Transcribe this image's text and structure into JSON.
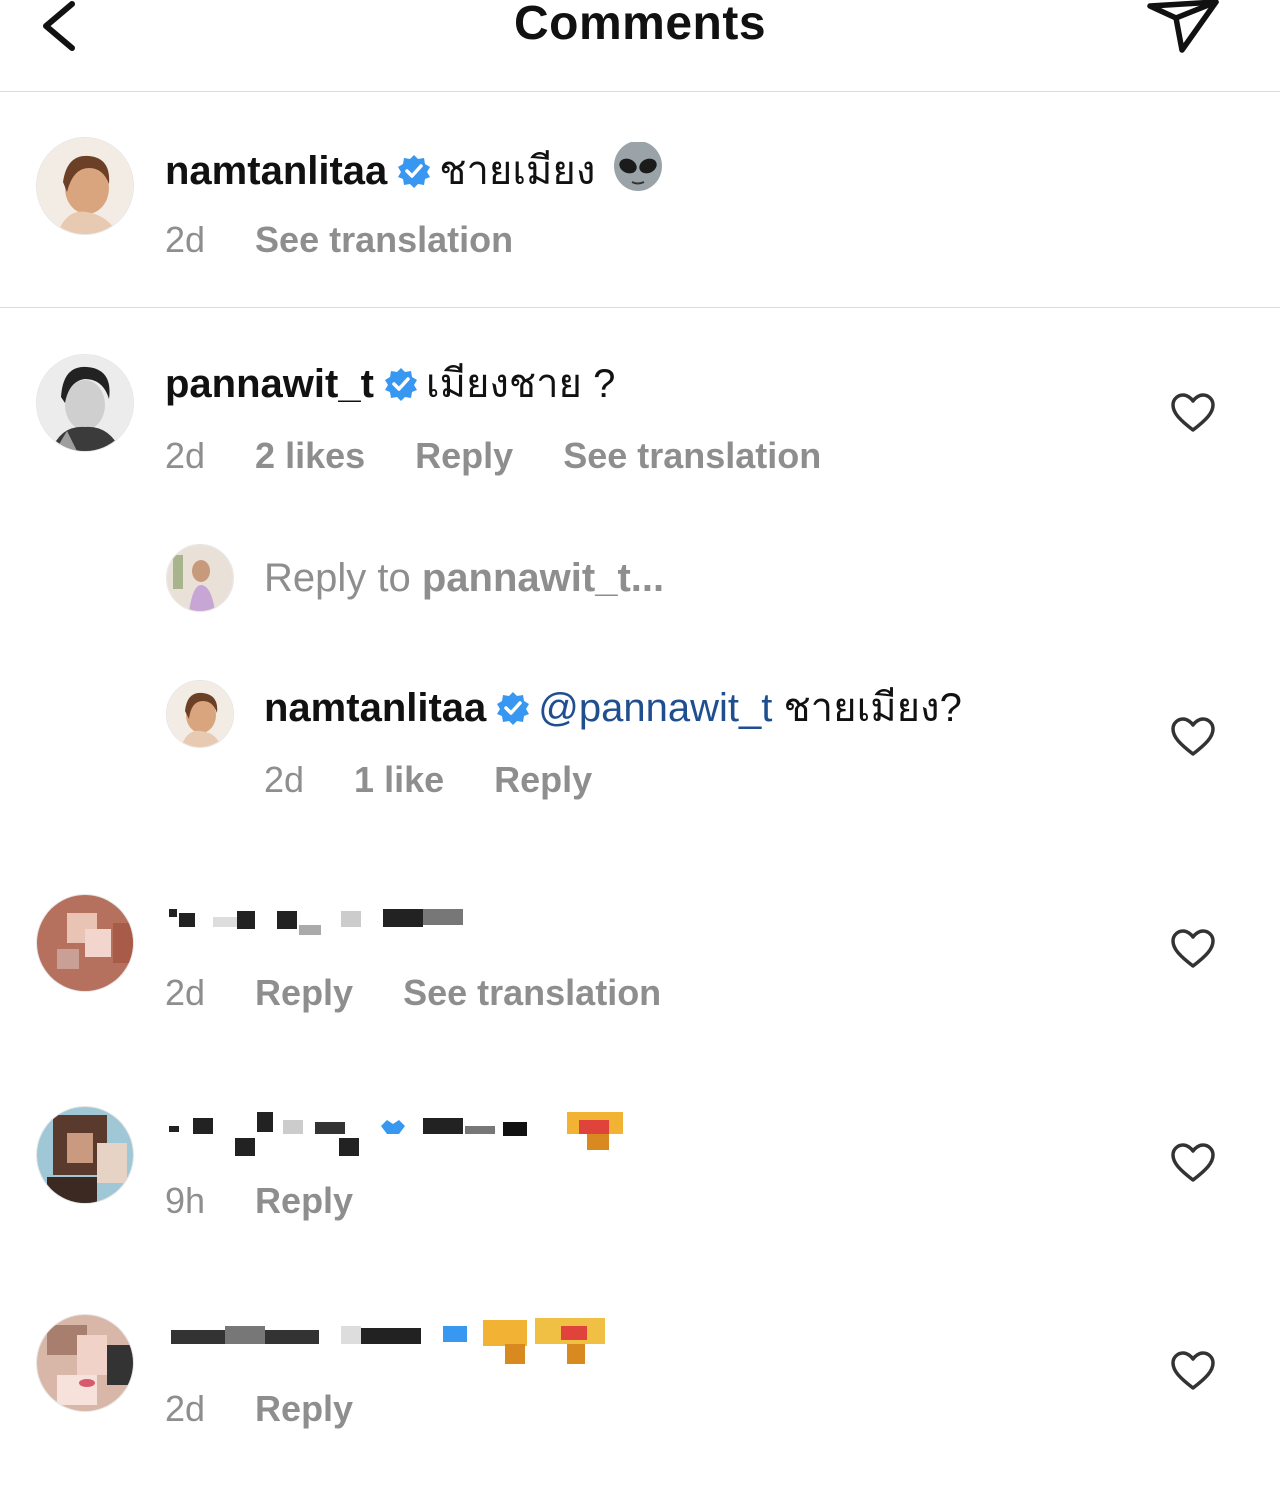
{
  "header": {
    "title": "Comments"
  },
  "caption": {
    "username": "namtanlitaa",
    "text": "ชายเมียง",
    "emoji": "alien-emoji",
    "time": "2d",
    "see_translation": "See translation"
  },
  "comments": [
    {
      "username": "pannawit_t",
      "text": "เมียงชาย ?",
      "time": "2d",
      "likes": "2 likes",
      "reply": "Reply",
      "see_translation": "See translation"
    },
    {
      "username": "",
      "text": "",
      "time": "2d",
      "reply": "Reply",
      "see_translation": "See translation"
    },
    {
      "username": "",
      "text": "",
      "time": "9h",
      "reply": "Reply"
    },
    {
      "username": "",
      "text": "",
      "time": "2d",
      "reply": "Reply"
    }
  ],
  "reply_prompt": {
    "prefix": "Reply to ",
    "target": "pannawit_t..."
  },
  "reply": {
    "username": "namtanlitaa",
    "mention": "@pannawit_t",
    "text": "ชายเมียง?",
    "time": "2d",
    "likes": "1 like",
    "reply": "Reply"
  },
  "colors": {
    "verified": "#3897f0",
    "meta": "#8e8e8e",
    "mention": "#1f4f8f",
    "divider": "#dbdbdb"
  }
}
